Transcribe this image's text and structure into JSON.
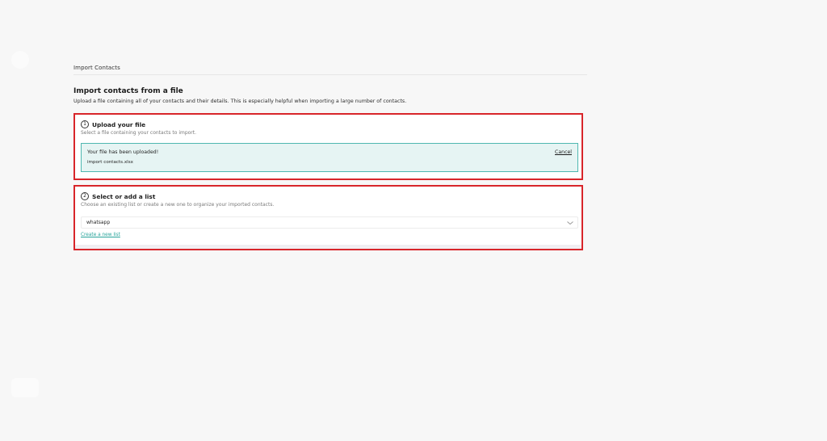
{
  "breadcrumb": {
    "label": "Import Contacts"
  },
  "section": {
    "title": "Import contacts from a file",
    "description": "Upload a file containing all of your contacts and their details. This is especially helpful when importing a large number of contacts."
  },
  "step1": {
    "number": "1",
    "title": "Upload your file",
    "subtitle": "Select a file containing your contacts to import.",
    "status_message": "Your file has been uploaded!",
    "file_name": "import contacts.xlsx",
    "cancel_label": "Cancel"
  },
  "step2": {
    "number": "2",
    "title": "Select or add a list",
    "subtitle": "Choose an existing list or create a new one to organize your imported contacts.",
    "selected_list": "whatsapp",
    "create_link_label": "Create a new list"
  },
  "colors": {
    "highlight_border": "#d8252a",
    "accent_teal": "#27a39a",
    "upload_bg": "#e6f4f3"
  },
  "icons": [
    "chevron-down-icon"
  ]
}
